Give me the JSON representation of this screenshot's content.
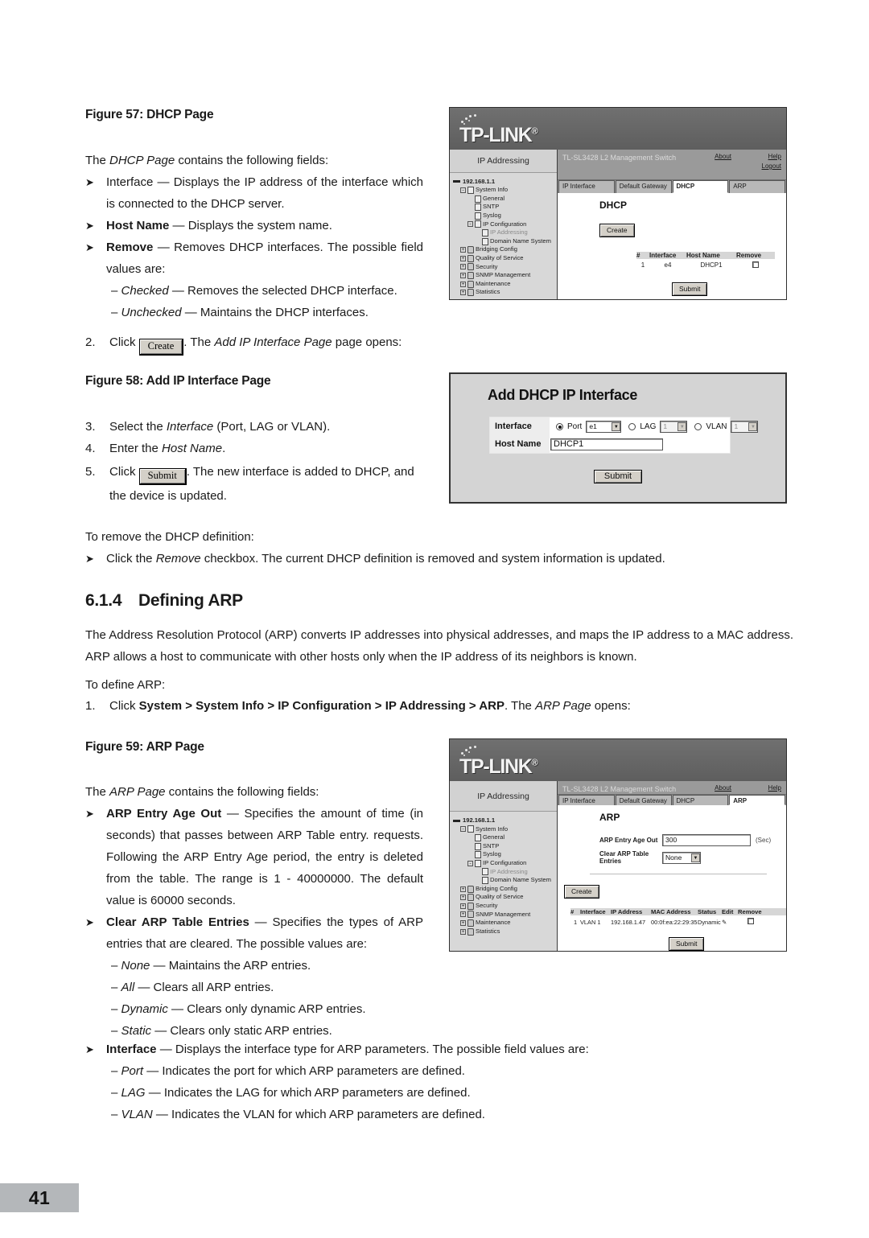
{
  "page": {
    "number": "41"
  },
  "fig57": {
    "caption": "Figure 57: DHCP Page",
    "intro_pre": "The ",
    "intro_it": "DHCP Page",
    "intro_post": " contains the following fields:",
    "bullets": [
      {
        "term": "Interface",
        "term_style": "plain",
        "text": " — Displays the IP address of the interface which is connected to the DHCP server."
      },
      {
        "term": "Host Name",
        "term_style": "bold",
        "text": " — Displays the system name."
      },
      {
        "term": "Remove",
        "term_style": "bold",
        "text": " — Removes DHCP interfaces. The possible field values are:"
      }
    ],
    "sub": [
      {
        "it": "Checked",
        "text": " — Removes the selected DHCP interface."
      },
      {
        "it": "Unchecked",
        "text": " — Maintains the DHCP interfaces."
      }
    ],
    "step2_num": "2.",
    "step2_click": "Click",
    "step2_btn": "Create",
    "step2_pre": ". The ",
    "step2_it": "Add IP Interface Page",
    "step2_post": " page opens:"
  },
  "fig58": {
    "caption": "Figure 58: Add IP Interface Page",
    "steps": [
      {
        "num": "3.",
        "pre": "Select the ",
        "it": "Interface",
        "post": " (Port, LAG or VLAN)."
      },
      {
        "num": "4.",
        "pre": "Enter the ",
        "it": "Host Name",
        "post": "."
      }
    ],
    "step5_num": "5.",
    "step5_click": "Click",
    "step5_btn": "Submit",
    "step5_post": ". The new interface is added to DHCP, and the device is updated."
  },
  "remove_def": {
    "lead": "To remove the DHCP definition:",
    "bullet_pre": "Click the ",
    "bullet_it": "Remove",
    "bullet_post": " checkbox. The current DHCP definition is removed and system information is updated."
  },
  "section": {
    "number": "6.1.4",
    "title": "Defining ARP",
    "para": "The Address Resolution Protocol (ARP) converts IP addresses into physical addresses, and maps the IP address to a MAC address. ARP allows a host to communicate with other hosts only when the IP address of its neighbors is known.",
    "to_define": "To define ARP:",
    "step1_num": "1.",
    "step1_pre": "Click ",
    "step1_bold": "System > System Info > IP Configuration > IP Addressing > ARP",
    "step1_mid": ". The ",
    "step1_it": "ARP Page",
    "step1_post": " opens:"
  },
  "fig59": {
    "caption": "Figure 59: ARP Page",
    "intro_pre": "The ",
    "intro_it": "ARP Page",
    "intro_post": " contains the following fields:",
    "b1_term": "ARP Entry Age Out",
    "b1_text": " — Specifies the amount of time (in seconds) that passes between ARP Table entry. requests. Following the ARP Entry Age period, the entry is deleted from the table. The range is 1 - 40000000. The default value is 60000 seconds.",
    "b2_term": "Clear ARP Table Entries",
    "b2_text": " — Specifies the types of ARP entries that are cleared. The possible values are:",
    "b2_sub": [
      {
        "it": "None",
        "text": " — Maintains the ARP entries."
      },
      {
        "it": "All",
        "text": " — Clears all ARP entries."
      },
      {
        "it": "Dynamic",
        "text": " — Clears only dynamic ARP entries."
      },
      {
        "it": "Static",
        "text": " — Clears only static ARP entries."
      }
    ],
    "b3_term": "Interface",
    "b3_text": " — Displays the interface type for ARP parameters. The possible field values are:",
    "b3_sub": [
      {
        "it": "Port",
        "text": " — Indicates the port for which ARP parameters are defined."
      },
      {
        "it": "LAG",
        "text": " — Indicates the LAG for which ARP parameters are defined."
      },
      {
        "it": "VLAN",
        "text": " — Indicates the VLAN for which ARP parameters are defined."
      }
    ]
  },
  "ui": {
    "brand": "TP-LINK",
    "brand_mark": "®",
    "left_title": "IP Addressing",
    "model": "TL-SL3428 L2 Management Switch",
    "link_about": "About",
    "link_help": "Help",
    "link_logout": "Logout",
    "tabs": [
      "IP Interface",
      "Default Gateway",
      "DHCP",
      "ARP"
    ],
    "tree": [
      {
        "label": "192.168.1.1",
        "depth": 0,
        "pm": "",
        "icon": "root",
        "bold": true,
        "dim": false
      },
      {
        "label": "System Info",
        "depth": 1,
        "pm": "-",
        "icon": "file",
        "bold": false,
        "dim": false
      },
      {
        "label": "General",
        "depth": 2,
        "pm": "",
        "icon": "file",
        "bold": false,
        "dim": false
      },
      {
        "label": "SNTP",
        "depth": 2,
        "pm": "",
        "icon": "file",
        "bold": false,
        "dim": false
      },
      {
        "label": "Syslog",
        "depth": 2,
        "pm": "",
        "icon": "file",
        "bold": false,
        "dim": false
      },
      {
        "label": "IP Configuration",
        "depth": 2,
        "pm": "-",
        "icon": "file",
        "bold": false,
        "dim": false
      },
      {
        "label": "IP Addressing",
        "depth": 3,
        "pm": "",
        "icon": "file",
        "bold": false,
        "dim": true
      },
      {
        "label": "Domain Name System",
        "depth": 3,
        "pm": "",
        "icon": "file",
        "bold": false,
        "dim": false
      },
      {
        "label": "Bridging Config",
        "depth": 1,
        "pm": "+",
        "icon": "folder",
        "bold": false,
        "dim": false
      },
      {
        "label": "Quality of Service",
        "depth": 1,
        "pm": "+",
        "icon": "folder",
        "bold": false,
        "dim": false
      },
      {
        "label": "Security",
        "depth": 1,
        "pm": "+",
        "icon": "folder",
        "bold": false,
        "dim": false
      },
      {
        "label": "SNMP Management",
        "depth": 1,
        "pm": "+",
        "icon": "folder",
        "bold": false,
        "dim": false
      },
      {
        "label": "Maintenance",
        "depth": 1,
        "pm": "+",
        "icon": "folder",
        "bold": false,
        "dim": false
      },
      {
        "label": "Statistics",
        "depth": 1,
        "pm": "+",
        "icon": "folder",
        "bold": false,
        "dim": false
      }
    ]
  },
  "dhcp_page": {
    "title": "DHCP",
    "create_label": "Create",
    "submit_label": "Submit",
    "table_headers": [
      "#",
      "Interface",
      "Host Name",
      "Remove"
    ],
    "rows": [
      {
        "idx": "1",
        "interface": "e4",
        "host_name": "DHCP1",
        "remove": false
      }
    ]
  },
  "add_dlg": {
    "title": "Add DHCP IP Interface",
    "interface_label": "Interface",
    "host_label": "Host Name",
    "port_label": "Port",
    "port_value": "e1",
    "lag_label": "LAG",
    "lag_value": "1",
    "vlan_label": "VLAN",
    "vlan_value": "1",
    "host_value": "DHCP1",
    "submit_label": "Submit",
    "selected": "Port"
  },
  "arp_page": {
    "title": "ARP",
    "age_label": "ARP Entry Age Out",
    "age_value": "300",
    "age_unit": "(Sec)",
    "clear_label": "Clear ARP Table Entries",
    "clear_value": "None",
    "create_label": "Create",
    "submit_label": "Submit",
    "table_headers": [
      "#",
      "Interface",
      "IP Address",
      "MAC Address",
      "Status",
      "Edit",
      "Remove"
    ],
    "rows": [
      {
        "idx": "1",
        "interface": "VLAN 1",
        "ip": "192.168.1.47",
        "mac": "00:0f:ea:22:29:35",
        "status": "Dynamic",
        "remove": false
      }
    ]
  }
}
